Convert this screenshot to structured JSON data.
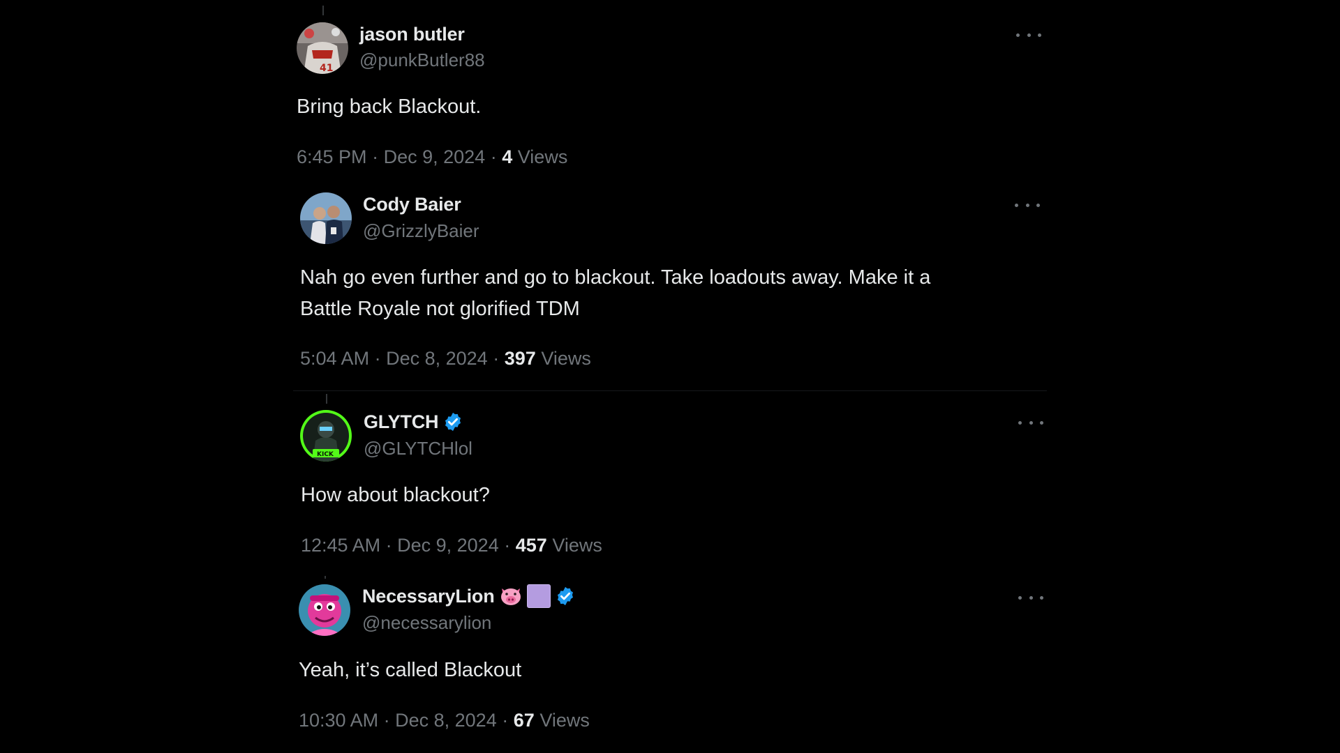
{
  "tweets": [
    {
      "display_name": "jason butler",
      "handle": "@punkButler88",
      "text": "Bring back Blackout.",
      "time": "6:45 PM",
      "date": "Dec 9, 2024",
      "views_count": "4",
      "views_label": "Views",
      "separator": "·",
      "verified": false,
      "avatar": "avatar-jersey-photo"
    },
    {
      "display_name": "Cody Baier",
      "handle": "@GrizzlyBaier",
      "text_line1": "Nah go even further and go to blackout. Take loadouts away. Make it a",
      "text_line2": "Battle Royale not glorified TDM",
      "time": "5:04 AM",
      "date": "Dec 8, 2024",
      "views_count": "397",
      "views_label": "Views",
      "separator": "·",
      "verified": false,
      "avatar": "avatar-couple-photo"
    },
    {
      "display_name": "GLYTCH",
      "handle": "@GLYTCHlol",
      "text": "How about blackout?",
      "time": "12:45 AM",
      "date": "Dec 9, 2024",
      "views_count": "457",
      "views_label": "Views",
      "separator": "·",
      "verified": true,
      "avatar": "avatar-kick-green"
    },
    {
      "display_name": "NecessaryLion",
      "handle": "@necessarylion",
      "text": "Yeah, it’s called Blackout",
      "time": "10:30 AM",
      "date": "Dec 8, 2024",
      "views_count": "67",
      "views_label": "Views",
      "separator": "·",
      "verified": true,
      "emojis": [
        "pig-face-emoji",
        "purple-square-emoji"
      ],
      "avatar": "avatar-pink-character"
    }
  ],
  "colors": {
    "background": "#000000",
    "primary_text": "#e7e9ea",
    "secondary_text": "#71767b",
    "verified_blue": "#1d9bf0"
  }
}
